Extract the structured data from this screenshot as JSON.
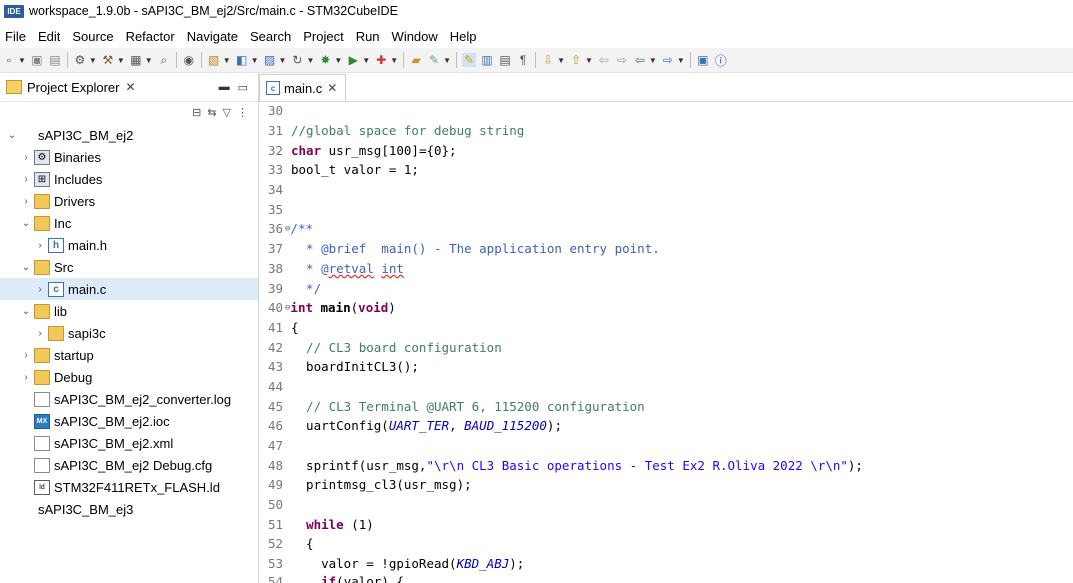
{
  "window": {
    "app_badge": "IDE",
    "title": "workspace_1.9.0b - sAPI3C_BM_ej2/Src/main.c - STM32CubeIDE"
  },
  "menu": [
    "File",
    "Edit",
    "Source",
    "Refactor",
    "Navigate",
    "Search",
    "Project",
    "Run",
    "Window",
    "Help"
  ],
  "project_explorer": {
    "tab_label": "Project Explorer",
    "tree": [
      {
        "label": "sAPI3C_BM_ej2",
        "depth": 0,
        "arrow": "v",
        "icon": "project",
        "iconname": "project-icon"
      },
      {
        "label": "Binaries",
        "depth": 1,
        "arrow": ">",
        "icon": "bin",
        "iconname": "binaries-icon"
      },
      {
        "label": "Includes",
        "depth": 1,
        "arrow": ">",
        "icon": "inc",
        "iconname": "includes-icon"
      },
      {
        "label": "Drivers",
        "depth": 1,
        "arrow": ">",
        "icon": "folder",
        "iconname": "folder-icon"
      },
      {
        "label": "Inc",
        "depth": 1,
        "arrow": "v",
        "icon": "folder",
        "iconname": "folder-icon"
      },
      {
        "label": "main.h",
        "depth": 2,
        "arrow": ">",
        "icon": "hfile",
        "iconname": "header-file-icon"
      },
      {
        "label": "Src",
        "depth": 1,
        "arrow": "v",
        "icon": "folder",
        "iconname": "folder-icon"
      },
      {
        "label": "main.c",
        "depth": 2,
        "arrow": ">",
        "icon": "cfile",
        "iconname": "c-file-icon",
        "selected": true
      },
      {
        "label": "lib",
        "depth": 1,
        "arrow": "v",
        "icon": "folder",
        "iconname": "folder-icon"
      },
      {
        "label": "sapi3c",
        "depth": 2,
        "arrow": ">",
        "icon": "folder",
        "iconname": "folder-icon"
      },
      {
        "label": "startup",
        "depth": 1,
        "arrow": ">",
        "icon": "folder",
        "iconname": "folder-icon"
      },
      {
        "label": "Debug",
        "depth": 1,
        "arrow": ">",
        "icon": "folder",
        "iconname": "folder-icon"
      },
      {
        "label": "sAPI3C_BM_ej2_converter.log",
        "depth": 1,
        "arrow": "",
        "icon": "file",
        "iconname": "file-icon"
      },
      {
        "label": "sAPI3C_BM_ej2.ioc",
        "depth": 1,
        "arrow": "",
        "icon": "mx",
        "iconname": "mx-file-icon"
      },
      {
        "label": "sAPI3C_BM_ej2.xml",
        "depth": 1,
        "arrow": "",
        "icon": "file",
        "iconname": "file-icon"
      },
      {
        "label": "sAPI3C_BM_ej2 Debug.cfg",
        "depth": 1,
        "arrow": "",
        "icon": "file",
        "iconname": "file-icon"
      },
      {
        "label": "STM32F411RETx_FLASH.ld",
        "depth": 1,
        "arrow": "",
        "icon": "ld",
        "iconname": "linker-file-icon"
      },
      {
        "label": "sAPI3C_BM_ej3",
        "depth": 0,
        "arrow": "",
        "icon": "project",
        "iconname": "project-icon"
      }
    ]
  },
  "editor": {
    "tab_label": "main.c",
    "lines": [
      {
        "n": "30",
        "t": ""
      },
      {
        "n": "31",
        "t": "//global space for debug string"
      },
      {
        "n": "32",
        "t": "char usr_msg[100]={0};"
      },
      {
        "n": "33",
        "t": "bool_t valor = 1;"
      },
      {
        "n": "34",
        "t": ""
      },
      {
        "n": "35",
        "t": ""
      },
      {
        "n": "36",
        "t": "/**"
      },
      {
        "n": "37",
        "t": "  * @brief  main() - The application entry point."
      },
      {
        "n": "38",
        "t": "  * @retval int"
      },
      {
        "n": "39",
        "t": "  */"
      },
      {
        "n": "40",
        "t": "int main(void)"
      },
      {
        "n": "41",
        "t": "{"
      },
      {
        "n": "42",
        "t": "  // CL3 board configuration"
      },
      {
        "n": "43",
        "t": "  boardInitCL3();"
      },
      {
        "n": "44",
        "t": ""
      },
      {
        "n": "45",
        "t": "  // CL3 Terminal @UART 6, 115200 configuration"
      },
      {
        "n": "46",
        "t": "  uartConfig(UART_TER, BAUD_115200);"
      },
      {
        "n": "47",
        "t": ""
      },
      {
        "n": "48",
        "t": "  sprintf(usr_msg,\"\\r\\n CL3 Basic operations - Test Ex2 R.Oliva 2022 \\r\\n\");"
      },
      {
        "n": "49",
        "t": "  printmsg_cl3(usr_msg);"
      },
      {
        "n": "50",
        "t": ""
      },
      {
        "n": "51",
        "t": "  while (1)"
      },
      {
        "n": "52",
        "t": "  {"
      },
      {
        "n": "53",
        "t": "    valor = !gpioRead(KBD_ABJ);"
      }
    ],
    "partial_bottom": {
      "n": "54",
      "t": "    if(valor) {"
    }
  }
}
